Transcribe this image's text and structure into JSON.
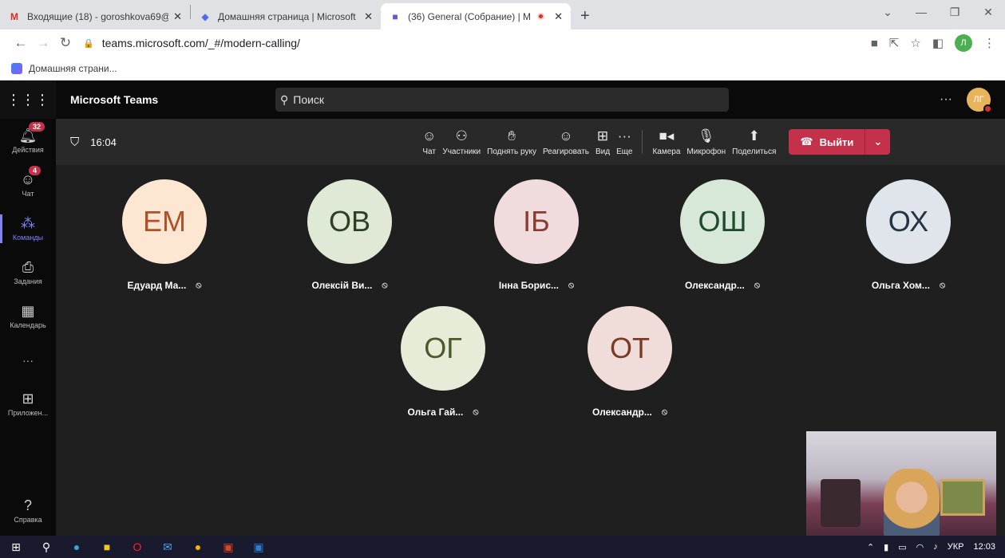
{
  "browser": {
    "tabs": [
      {
        "label": "Входящие (18) - goroshkova69@",
        "icon": "gmail-icon",
        "active": false
      },
      {
        "label": "Домашняя страница | Microsoft",
        "icon": "microsoft-icon",
        "active": false
      },
      {
        "label": "(36) General (Собрание) | M",
        "icon": "teams-icon",
        "active": true
      }
    ],
    "close_glyph": "✕",
    "new_tab_glyph": "+",
    "url": "teams.microsoft.com/_#/modern-calling/",
    "profile_initial": "Л",
    "bookmark_label": "Домашняя страни..."
  },
  "teams": {
    "app_name": "Microsoft Teams",
    "search_placeholder": "Поиск",
    "more_glyph": "···",
    "user_initials": "ЛГ",
    "rail": [
      {
        "label": "Действия",
        "icon": "bell-icon",
        "badge": "32"
      },
      {
        "label": "Чат",
        "icon": "chat-icon",
        "badge": "4"
      },
      {
        "label": "Команды",
        "icon": "teams-icon",
        "badge": ""
      },
      {
        "label": "Задания",
        "icon": "assignments-icon",
        "badge": ""
      },
      {
        "label": "Календарь",
        "icon": "calendar-icon",
        "badge": ""
      },
      {
        "label": "···",
        "icon": "more-icon",
        "badge": ""
      },
      {
        "label": "Приложен...",
        "icon": "apps-icon",
        "badge": ""
      }
    ],
    "help_label": "Справка",
    "meeting": {
      "timer": "16:04",
      "controls": [
        {
          "label": "Чат",
          "icon": "chat-icon"
        },
        {
          "label": "Участники",
          "icon": "participants-icon"
        },
        {
          "label": "Поднять руку",
          "icon": "raise-hand-icon"
        },
        {
          "label": "Реагировать",
          "icon": "react-icon"
        },
        {
          "label": "Вид",
          "icon": "view-icon"
        },
        {
          "label": "Еще",
          "icon": "more-icon"
        }
      ],
      "device_controls": [
        {
          "label": "Камера",
          "icon": "camera-icon"
        },
        {
          "label": "Микрофон",
          "icon": "microphone-icon"
        },
        {
          "label": "Поделиться",
          "icon": "share-icon"
        }
      ],
      "leave_label": "Выйти"
    },
    "participants": [
      {
        "initials": "ЕМ",
        "name": "Едуард Ма...",
        "bg": "#fde6d2",
        "fg": "#b0502a"
      },
      {
        "initials": "ОВ",
        "name": "Олексій Ви...",
        "bg": "#e0e8d6",
        "fg": "#2e3f22"
      },
      {
        "initials": "ІБ",
        "name": "Інна Борис...",
        "bg": "#f0dcdc",
        "fg": "#8a3a30"
      },
      {
        "initials": "ОШ",
        "name": "Олександр...",
        "bg": "#d8e8d8",
        "fg": "#1e4a2e"
      },
      {
        "initials": "ОХ",
        "name": "Ольга Хом...",
        "bg": "#dfe5ea",
        "fg": "#243442"
      },
      {
        "initials": "ОГ",
        "name": "Ольга Гай...",
        "bg": "#e6ecd8",
        "fg": "#4a5a2a"
      },
      {
        "initials": "ОТ",
        "name": "Олександр...",
        "bg": "#f0dcd8",
        "fg": "#7a3a26"
      }
    ]
  },
  "taskbar": {
    "lang": "УКР",
    "time": "12:03"
  }
}
